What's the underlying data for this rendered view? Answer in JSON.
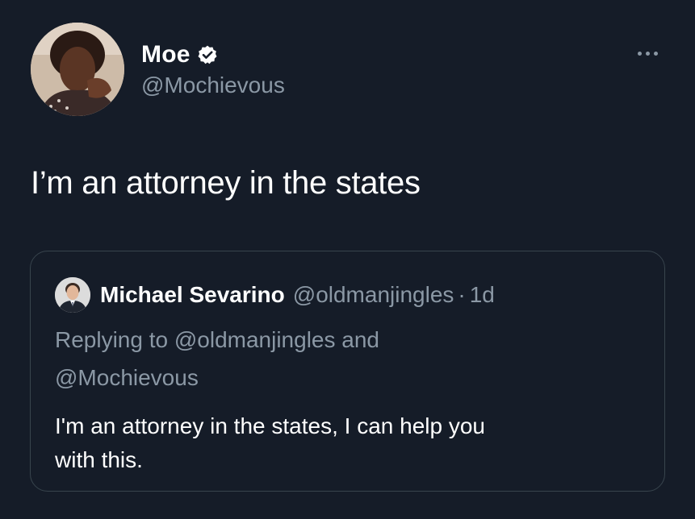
{
  "tweet": {
    "author": {
      "display_name": "Moe",
      "handle": "@Mochievous",
      "verified": true,
      "avatar_icon": "profile-photo"
    },
    "text": "I’m an attorney in the states",
    "more_icon": "more-horizontal-icon"
  },
  "quoted_tweet": {
    "author": {
      "display_name": "Michael Sevarino",
      "handle": "@oldmanjingles",
      "avatar_icon": "profile-photo"
    },
    "separator": "·",
    "time": "1d",
    "replying_to": {
      "line1": "Replying to @oldmanjingles and",
      "line2": "@Mochievous"
    },
    "text_lines": [
      "I'm an attorney in the states, I can help you",
      "with this."
    ]
  },
  "colors": {
    "background": "#151c28",
    "text_primary": "#ffffff",
    "text_secondary": "#8b98a5",
    "border": "#38444d"
  }
}
